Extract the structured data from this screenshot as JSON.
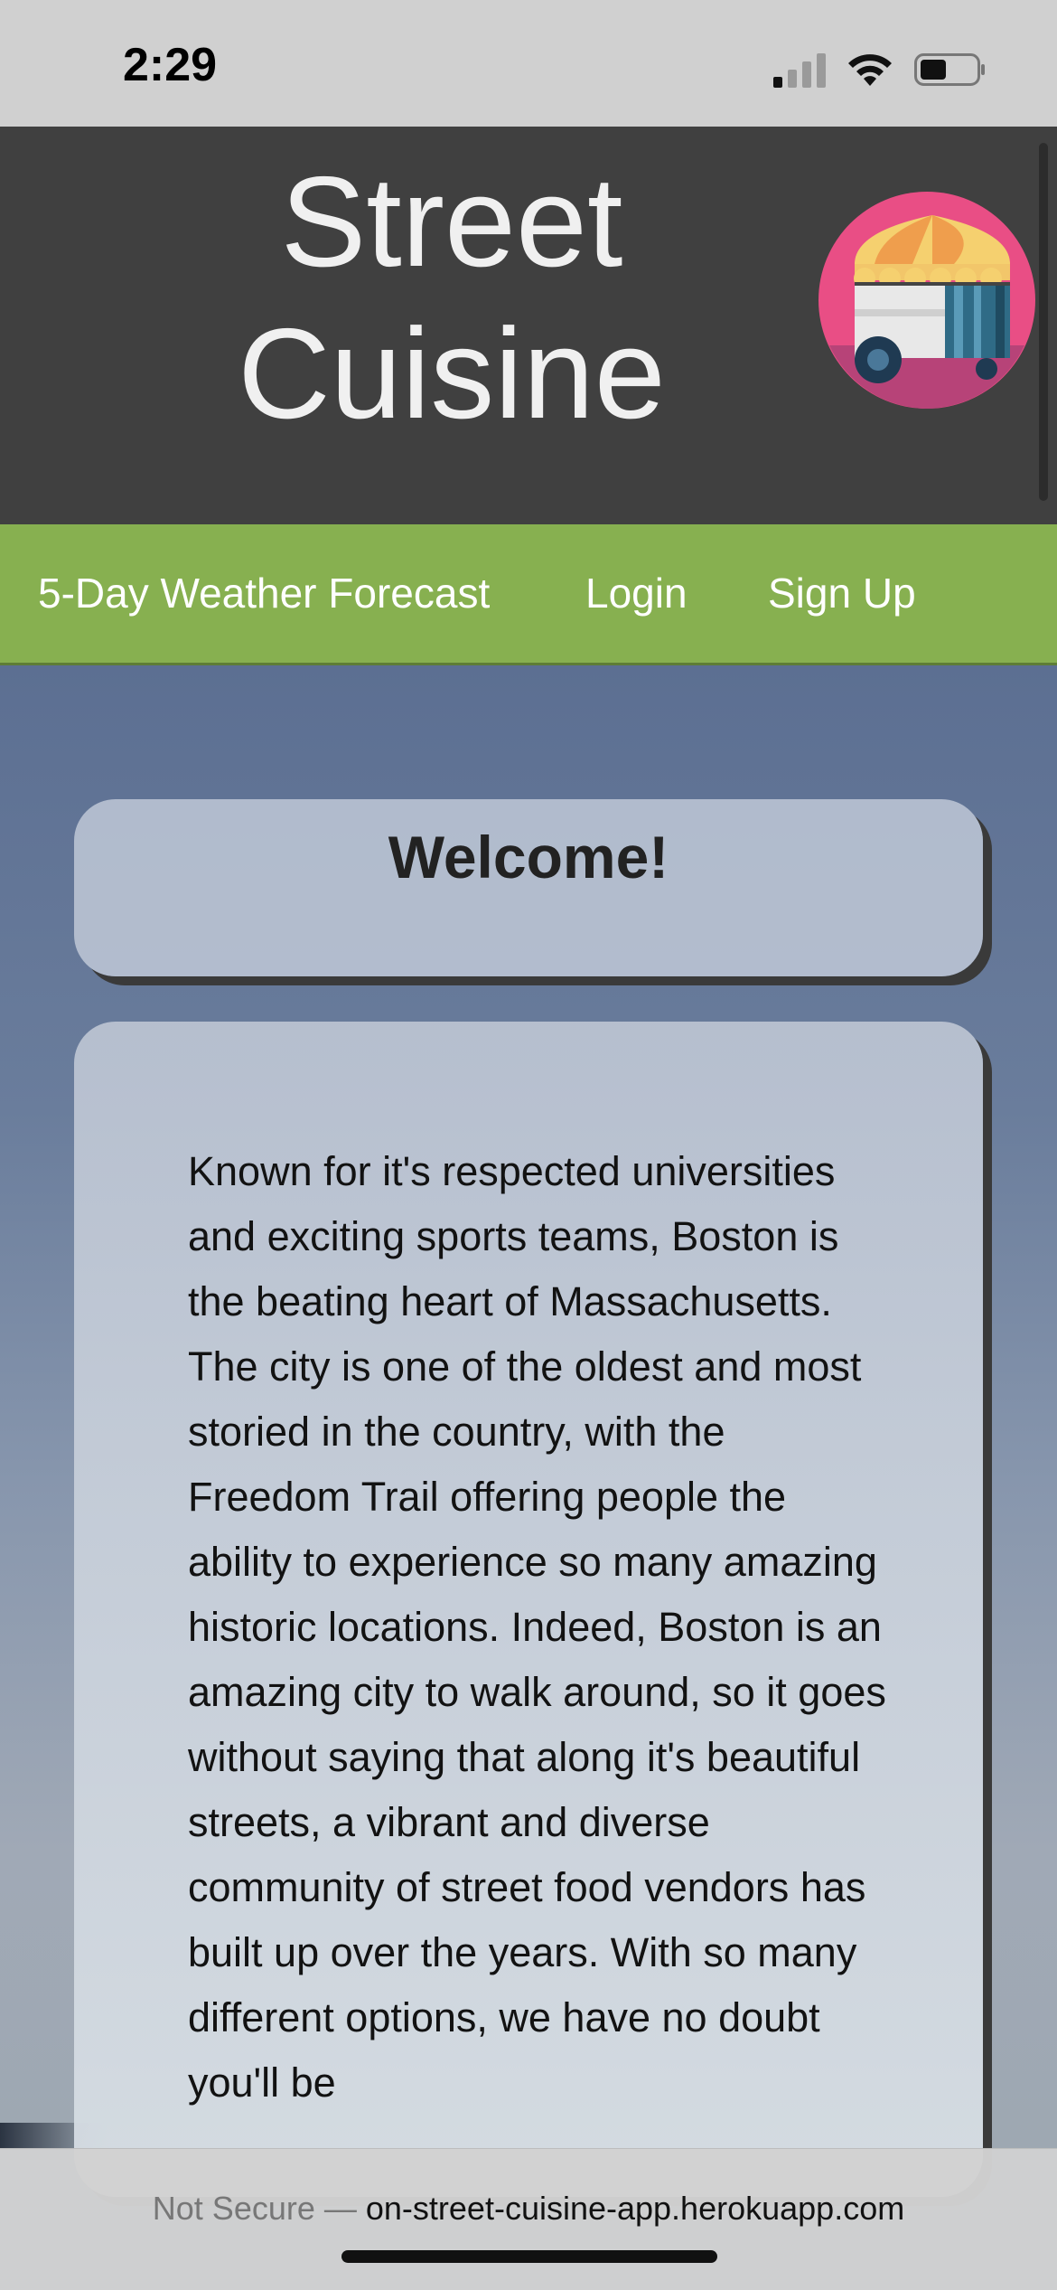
{
  "status_bar": {
    "time": "2:29",
    "icons": [
      "cellular-signal-icon",
      "wifi-icon",
      "battery-icon"
    ]
  },
  "header": {
    "title_line1": "Street",
    "title_line2": "Cuisine",
    "logo": "food-cart-logo"
  },
  "nav": {
    "items": [
      {
        "label": "5-Day Weather Forecast"
      },
      {
        "label": "Login"
      },
      {
        "label": "Sign Up"
      }
    ]
  },
  "welcome": {
    "title": "Welcome!"
  },
  "about": {
    "text": "Known for it's respected universities and exciting sports teams, Boston is the beating heart of Massachusetts. The city is one of the oldest and most storied in the country, with the Freedom Trail offering people the ability to experience so many amazing historic locations. Indeed, Boston is an amazing city to walk around, so it goes without saying that along it's beautiful streets, a vibrant and diverse community of street food vendors has built up over the years. With so many different options, we have no doubt you'll be"
  },
  "browser": {
    "security_label": "Not Secure —",
    "url": "on-street-cuisine-app.herokuapp.com"
  },
  "colors": {
    "header_bg": "#404040",
    "nav_bg": "#87b050",
    "logo_circle": "#e94e85"
  }
}
